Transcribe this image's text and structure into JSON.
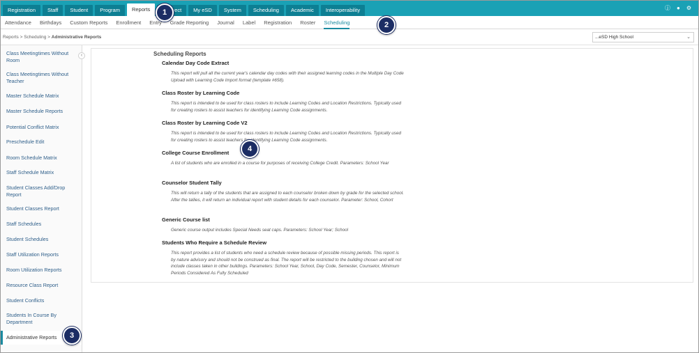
{
  "top_nav": {
    "tabs": [
      "Registration",
      "Staff",
      "Student",
      "Program",
      "Reports",
      "Connect",
      "My eSD",
      "System",
      "Scheduling",
      "Academic",
      "Interoperability"
    ],
    "active": "Reports",
    "right_icons": [
      "help-icon",
      "user-icon",
      "settings-icon"
    ]
  },
  "sub_nav": {
    "items": [
      "Attendance",
      "Birthdays",
      "Custom Reports",
      "Enrollment",
      "Entry",
      "Grade Reporting",
      "Journal",
      "Label",
      "Registration",
      "Roster",
      "Scheduling"
    ],
    "active": "Scheduling"
  },
  "breadcrumb": {
    "items": [
      "Reports",
      "Scheduling"
    ],
    "separator": ">",
    "current": "Administrative Reports"
  },
  "school_select": {
    "value": "...eSD High School"
  },
  "sidebar": {
    "items": [
      "Class Meetingtimes Without Room",
      "Class Meetingtimes Without Teacher",
      "Master Schedule Matrix",
      "Master Schedule Reports",
      "Potential Conflict Matrix",
      "Preschedule Edit",
      "Room Schedule Matrix",
      "Staff Schedule Matrix",
      "Student Classes Add/Drop Report",
      "Student Classes Report",
      "Staff Schedules",
      "Student Schedules",
      "Staff Utilization Reports",
      "Room Utilization Reports",
      "Resource Class Report",
      "Student Conflicts",
      "Students In Course By Department",
      "Administrative Reports"
    ],
    "active": "Administrative Reports"
  },
  "main": {
    "section_title": "Scheduling Reports",
    "reports": [
      {
        "title": "Calendar Day Code Extract",
        "description": "This report will pull all the current year's calendar day codes with their assigned learning codes in the Multiple Day Code Upload with Learning Code Import format (template #658)."
      },
      {
        "title": "Class Roster by Learning Code",
        "description": "This report is intended to be used for class rosters to include Learning Codes and Location Restrictions. Typically used for creating rosters to assist teachers for identifying Learning Code assignments."
      },
      {
        "title": "Class Roster by Learning Code V2",
        "description": "This report is intended to be used for class rosters to include Learning Codes and Location Restrictions. Typically used for creating rosters to assist teachers for identifying Learning Code assignments."
      },
      {
        "title": "College Course Enrollment",
        "description": "A list of students who are enrolled in a course for purposes of receiving College Credit. Parameters: School Year"
      },
      {
        "title": "Counselor Student Tally",
        "description": "This will return a tally of the students that are assigned to each counselor broken down by grade for the selected school. After the tallies, it will return an individual report with student details for each counselor. Parameter: School, Cohort"
      },
      {
        "title": "Generic Course list",
        "description": "Generic course output includes Special Needs seat caps. Parameters: School Year; School"
      },
      {
        "title": "Students Who Require a Schedule Review",
        "description": "This report provides a list of students who need a schedule review because of possible missing periods. This report is by nature advisory and should not be construed as final. The report will be restricted to the building chosen and will not include classes taken in other buildings. Parameters: School Year, School, Day Code, Semester, Counselor, Minimum Periods Considered As Fully Scheduled"
      }
    ]
  },
  "callouts": [
    "1",
    "2",
    "3",
    "4"
  ]
}
